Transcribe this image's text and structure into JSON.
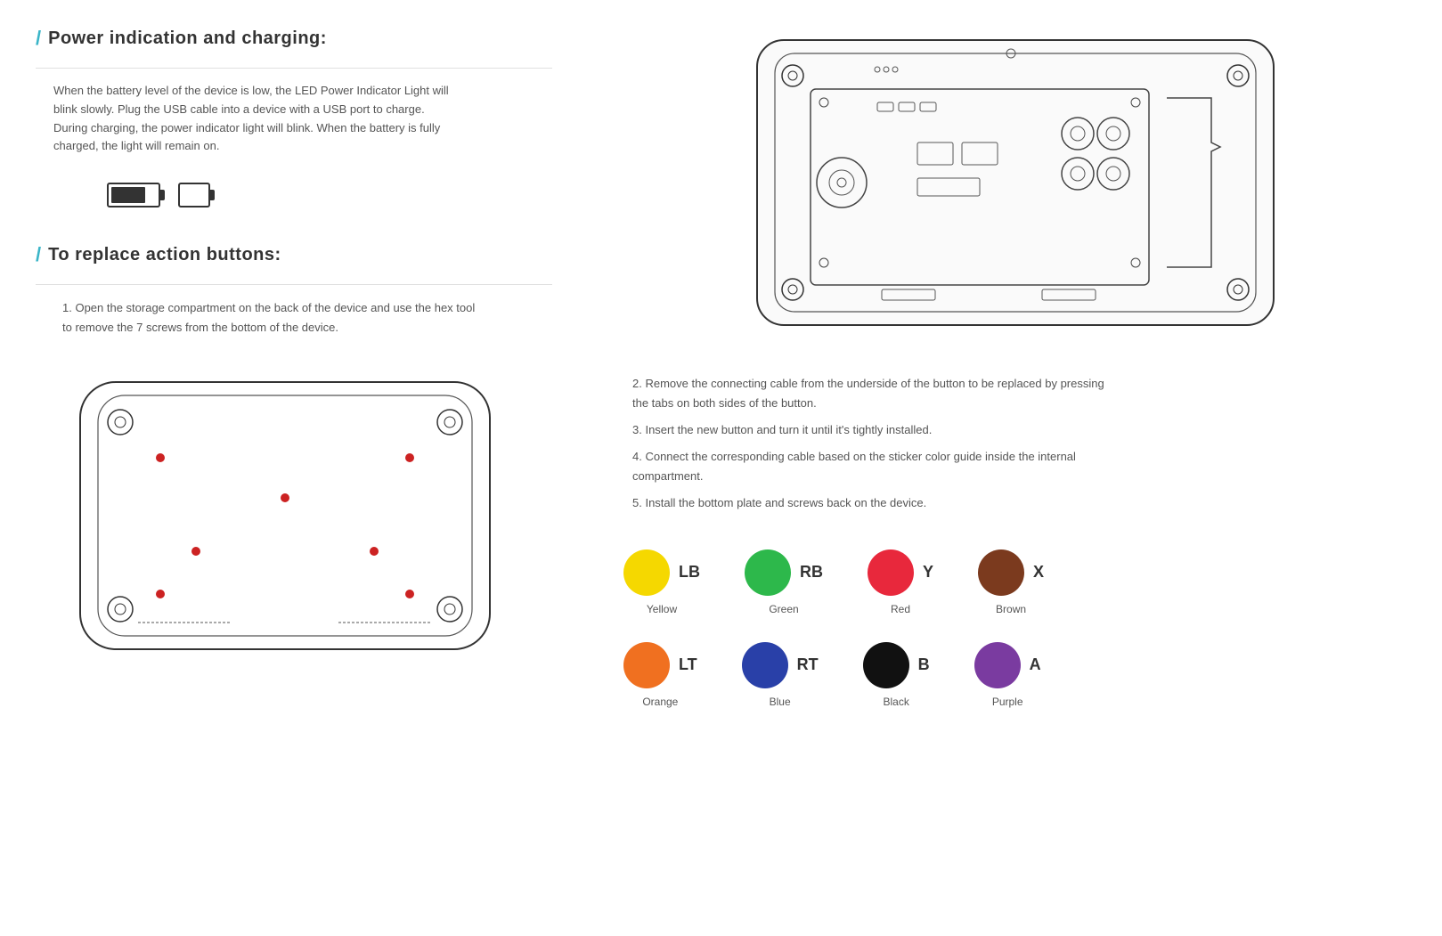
{
  "sections": {
    "power": {
      "tick": "/",
      "title": "Power indication and charging:",
      "description": "When the battery level of the device is low, the LED Power Indicator Light will blink slowly. Plug the USB cable into a device with a USB port to charge. During charging, the power indicator light will blink. When the battery is fully charged, the light will remain on."
    },
    "replace": {
      "tick": "/",
      "title": "To replace action buttons:",
      "step1": "1. Open the storage compartment on the back of the device and use the hex tool to remove the 7 screws from the bottom of the device.",
      "step2": "2. Remove the connecting cable from the underside of the button to be replaced by pressing the tabs on both sides of the button.",
      "step3": "3. Insert the new button and turn it until it's tightly installed.",
      "step4": "4. Connect the corresponding cable based on the sticker color guide inside the internal compartment.",
      "step5": "5. Install the bottom plate and screws back on the device."
    }
  },
  "colors": {
    "row1": [
      {
        "color": "#f5d800",
        "label": "LB",
        "name": "Yellow"
      },
      {
        "color": "#2db84b",
        "label": "RB",
        "name": "Green"
      },
      {
        "color": "#e8283c",
        "label": "Y",
        "name": "Red"
      },
      {
        "color": "#7b3a1e",
        "label": "X",
        "name": "Brown"
      }
    ],
    "row2": [
      {
        "color": "#f07020",
        "label": "LT",
        "name": "Orange"
      },
      {
        "color": "#2940a8",
        "label": "RT",
        "name": "Blue"
      },
      {
        "color": "#111111",
        "label": "B",
        "name": "Black"
      },
      {
        "color": "#7a3ba0",
        "label": "A",
        "name": "Purple"
      }
    ]
  }
}
